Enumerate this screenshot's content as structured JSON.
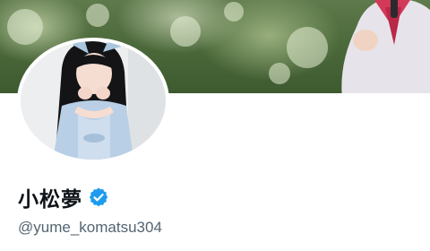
{
  "profile": {
    "display_name": "小松夢",
    "handle": "@yume_komatsu304",
    "verified": true,
    "verified_color": "#1d9bf0",
    "name_color": "#0f1419",
    "handle_color": "#536471"
  }
}
